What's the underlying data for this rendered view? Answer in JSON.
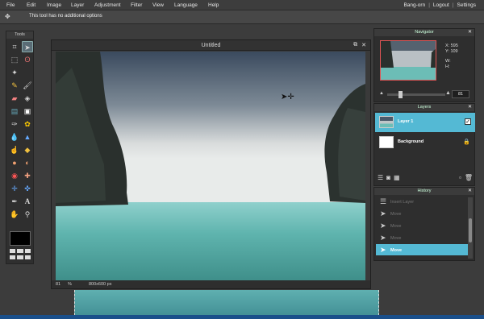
{
  "menubar": {
    "items": [
      "File",
      "Edit",
      "Image",
      "Layer",
      "Adjustment",
      "Filter",
      "View",
      "Language",
      "Help"
    ],
    "right": [
      "Bang-orn",
      "Logout",
      "Settings"
    ]
  },
  "options": {
    "message": "This tool has no additional options"
  },
  "tools": {
    "title": "Tools",
    "icons": [
      "crop-icon",
      "move-icon",
      "marquee-icon",
      "lasso-icon",
      "wand-icon",
      "",
      "pencil-icon",
      "brush-icon",
      "eraser-icon",
      "bucket-icon",
      "gradient-icon",
      "stamp-icon",
      "color-replace-icon",
      "pattern-icon",
      "blur-icon",
      "sharpen-icon",
      "smudge-icon",
      "sponge-icon",
      "dodge-icon",
      "burn-icon",
      "redeye-icon",
      "spot-heal-icon",
      "bloat-icon",
      "pinch-icon",
      "picker-icon",
      "text-icon",
      "hand-icon",
      "zoom-icon"
    ]
  },
  "document": {
    "title": "Untitled",
    "zoom": "81",
    "zoom_unit": "%",
    "size": "800x600 px"
  },
  "navigator": {
    "title": "Navigator",
    "x_label": "X:",
    "x_val": "595",
    "y_label": "Y:",
    "y_val": "109",
    "w_label": "W:",
    "h_label": "H:",
    "zoom": "81"
  },
  "layers": {
    "title": "Layers",
    "items": [
      {
        "name": "Layer 1"
      },
      {
        "name": "Background"
      }
    ]
  },
  "history": {
    "title": "History",
    "items": [
      "Insert Layer",
      "Move",
      "Move",
      "Move",
      "Move"
    ]
  }
}
